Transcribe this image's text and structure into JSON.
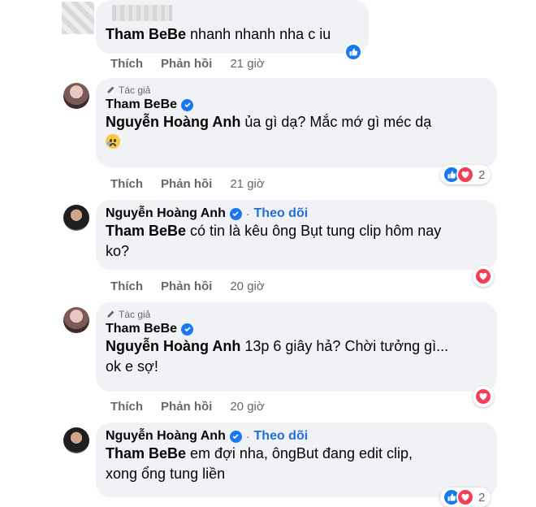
{
  "comments": [
    {
      "author": "Tham BeBe",
      "text": "nhanh nhanh nha c iu",
      "actions": {
        "like": "Thích",
        "reply": "Phản hồi",
        "time": "21 giờ"
      }
    },
    {
      "author_tag": "Tác giả",
      "author": "Tham BeBe",
      "mention": "Nguyễn Hoàng Anh",
      "text": "ủa gì dạ? Mắc mớ gì méc dạ",
      "actions": {
        "like": "Thích",
        "reply": "Phản hồi",
        "time": "21 giờ"
      },
      "reaction_count": "2"
    },
    {
      "author": "Nguyễn Hoàng Anh",
      "separator": "·",
      "follow": "Theo dõi",
      "mention": "Tham BeBe",
      "text_line1": "có tin là kêu ông Bụt tung clip hôm nay",
      "text_line2": "ko?",
      "actions": {
        "like": "Thích",
        "reply": "Phản hồi",
        "time": "20 giờ"
      }
    },
    {
      "author_tag": "Tác giả",
      "author": "Tham BeBe",
      "mention": "Nguyễn Hoàng Anh",
      "text_line1": "13p 6 giây hả? Chời tưởng gì...",
      "text_line2": "ok e sợ!",
      "actions": {
        "like": "Thích",
        "reply": "Phản hồi",
        "time": "20 giờ"
      }
    },
    {
      "author": "Nguyễn Hoàng Anh",
      "separator": "·",
      "follow": "Theo dõi",
      "mention": "Tham BeBe",
      "text_line1": "em đợi nha, ôngBut đang edit clip,",
      "text_line2": "xong ổng tung liền",
      "reaction_count": "2"
    }
  ],
  "icons": {
    "like": "like-reaction-icon",
    "love": "love-reaction-icon",
    "verified": "verified-badge-icon",
    "author": "pencil-icon",
    "sad": "sad-emoji-icon"
  },
  "colors": {
    "bubble": "#f0f2f5",
    "link": "#216fdb",
    "like": "#1877f2",
    "love": "#f33e58",
    "muted": "#65676b"
  }
}
